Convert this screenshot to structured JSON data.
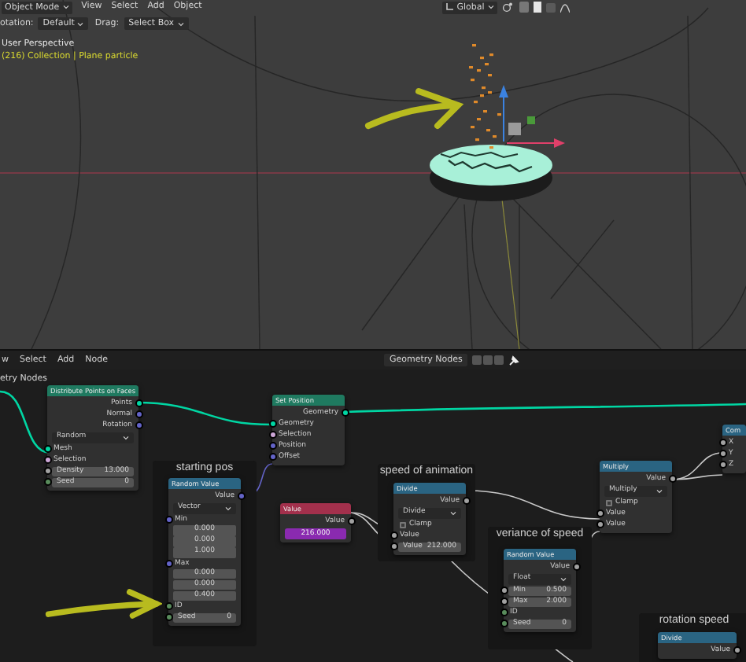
{
  "viewport": {
    "mode": "Object Mode",
    "menus": [
      "View",
      "Select",
      "Add",
      "Object"
    ],
    "orientation": "Global",
    "tool_settings": [
      {
        "label": "otation:",
        "value": "Default"
      },
      {
        "label": "Drag:",
        "value": "Select Box"
      }
    ],
    "overlay_text": [
      "User Perspective",
      "(216) Collection | Plane particle"
    ]
  },
  "node_editor": {
    "menus": [
      "w",
      "Select",
      "Add",
      "Node"
    ],
    "tree_name": "Geometry Nodes",
    "breadcrumb": "etry Nodes",
    "nodes": [
      {
        "kind": "node",
        "title": "Distribute Points on Faces",
        "color": "#1f7a60",
        "rows": [
          {
            "kind": "output",
            "label": "Points",
            "color": "#00d6a3"
          },
          {
            "kind": "output",
            "label": "Normal",
            "color": "#6363c7"
          },
          {
            "kind": "output",
            "label": "Rotation",
            "color": "#6363c7"
          },
          {
            "kind": "dropdown",
            "value": "Random"
          },
          {
            "kind": "input",
            "label": "Mesh",
            "color": "#00d6a3"
          },
          {
            "kind": "input",
            "label": "Selection",
            "color": "#cca6d6"
          },
          {
            "kind": "field",
            "label": "Density",
            "value": "13.000",
            "color": "#a1a1a1"
          },
          {
            "kind": "field",
            "label": "Seed",
            "value": "0",
            "color": "#598c5c"
          }
        ]
      },
      {
        "kind": "node",
        "title": "Set Position",
        "color": "#1f7a60",
        "rows": [
          {
            "kind": "output",
            "label": "Geometry",
            "color": "#00d6a3"
          },
          {
            "kind": "input",
            "label": "Geometry",
            "color": "#00d6a3"
          },
          {
            "kind": "input",
            "label": "Selection",
            "color": "#cca6d6"
          },
          {
            "kind": "input",
            "label": "Position",
            "color": "#6363c7"
          },
          {
            "kind": "input",
            "label": "Offset",
            "color": "#6363c7"
          }
        ]
      },
      {
        "kind": "frame",
        "title": "starting pos",
        "children": [
          {
            "kind": "node",
            "title": "Random Value",
            "color": "#2a6482",
            "rows": [
              {
                "kind": "output",
                "label": "Value",
                "color": "#6363c7"
              },
              {
                "kind": "dropdown",
                "value": "Vector"
              },
              {
                "kind": "vector",
                "label": "Min",
                "values": [
                  "0.000",
                  "0.000",
                  "1.000"
                ],
                "color": "#6363c7"
              },
              {
                "kind": "vector",
                "label": "Max",
                "values": [
                  "0.000",
                  "0.000",
                  "0.400"
                ],
                "color": "#6363c7"
              },
              {
                "kind": "input",
                "label": "ID",
                "color": "#598c5c"
              },
              {
                "kind": "field",
                "label": "Seed",
                "value": "0",
                "color": "#598c5c"
              }
            ]
          }
        ]
      },
      {
        "kind": "node",
        "title": "Value",
        "color": "#a3304c",
        "rows": [
          {
            "kind": "output",
            "label": "Value",
            "color": "#a1a1a1"
          },
          {
            "kind": "driven",
            "value": "216.000"
          }
        ]
      },
      {
        "kind": "frame",
        "title": "speed of animation",
        "children": [
          {
            "kind": "node",
            "title": "Divide",
            "color": "#2a6482",
            "rows": [
              {
                "kind": "output",
                "label": "Value",
                "color": "#a1a1a1"
              },
              {
                "kind": "dropdown",
                "value": "Divide"
              },
              {
                "kind": "checkbox",
                "label": "Clamp",
                "checked": false
              },
              {
                "kind": "input",
                "label": "Value",
                "color": "#a1a1a1"
              },
              {
                "kind": "field",
                "label": "Value",
                "value": "212.000",
                "color": "#a1a1a1"
              }
            ]
          }
        ]
      },
      {
        "kind": "frame",
        "title": "veriance of speed",
        "children": [
          {
            "kind": "node",
            "title": "Random Value",
            "color": "#2a6482",
            "rows": [
              {
                "kind": "output",
                "label": "Value",
                "color": "#a1a1a1"
              },
              {
                "kind": "dropdown",
                "value": "Float"
              },
              {
                "kind": "field",
                "label": "Min",
                "value": "0.500",
                "color": "#a1a1a1"
              },
              {
                "kind": "field",
                "label": "Max",
                "value": "2.000",
                "color": "#a1a1a1"
              },
              {
                "kind": "input",
                "label": "ID",
                "color": "#598c5c"
              },
              {
                "kind": "field",
                "label": "Seed",
                "value": "0",
                "color": "#598c5c"
              }
            ]
          }
        ]
      },
      {
        "kind": "node",
        "title": "Multiply",
        "color": "#2a6482",
        "rows": [
          {
            "kind": "output",
            "label": "Value",
            "color": "#a1a1a1"
          },
          {
            "kind": "dropdown",
            "value": "Multiply"
          },
          {
            "kind": "checkbox",
            "label": "Clamp",
            "checked": false
          },
          {
            "kind": "input",
            "label": "Value",
            "color": "#a1a1a1"
          },
          {
            "kind": "input",
            "label": "Value",
            "color": "#a1a1a1"
          }
        ]
      },
      {
        "kind": "node",
        "title": "Com",
        "color": "#2a6482",
        "rows": [
          {
            "kind": "input",
            "label": "X",
            "color": "#a1a1a1"
          },
          {
            "kind": "input",
            "label": "Y",
            "color": "#a1a1a1"
          },
          {
            "kind": "input",
            "label": "Z",
            "color": "#a1a1a1"
          }
        ]
      },
      {
        "kind": "frame",
        "title": "rotation speed",
        "children": [
          {
            "kind": "node",
            "title": "Divide",
            "color": "#2a6482",
            "rows": [
              {
                "kind": "output",
                "label": "Value",
                "color": "#a1a1a1"
              }
            ]
          }
        ]
      }
    ]
  }
}
